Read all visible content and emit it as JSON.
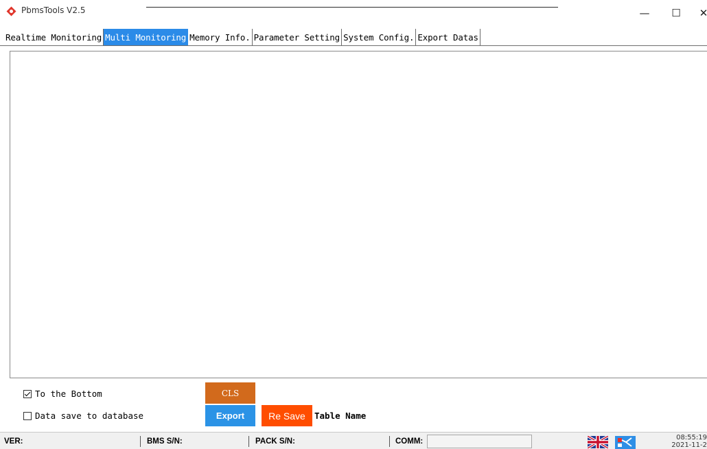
{
  "window": {
    "title": "PbmsTools V2.5",
    "minimize_glyph": "—",
    "maximize_glyph": "☐",
    "close_glyph": "✕"
  },
  "tabs": [
    {
      "label": "Realtime Monitoring",
      "active": false
    },
    {
      "label": "Multi Monitoring",
      "active": true
    },
    {
      "label": "Memory Info.",
      "active": false
    },
    {
      "label": "Parameter Setting",
      "active": false
    },
    {
      "label": "System Config.",
      "active": false
    },
    {
      "label": "Export Datas",
      "active": false
    }
  ],
  "controls": {
    "to_bottom_label": "To the Bottom",
    "to_bottom_checked": true,
    "save_db_label": "Data save to database",
    "save_db_checked": false,
    "cls_label": "CLS",
    "export_label": "Export",
    "resave_label": "Re Save",
    "table_name_label": "Table Name"
  },
  "statusbar": {
    "ver_label": "VER:",
    "bms_sn_label": "BMS S/N:",
    "pack_sn_label": "PACK S/N:",
    "comm_label": "COMM:",
    "time": "08:55:19",
    "date": "2021-11-2"
  },
  "colors": {
    "active_tab": "#2b8be8",
    "cls_button": "#d26a1c",
    "export_button": "#2b93e6",
    "resave_button": "#ff4d00"
  },
  "icons": {
    "app": "pbms-logo-icon",
    "language": "uk-flag-icon",
    "connection": "disconnected-plug-icon"
  }
}
